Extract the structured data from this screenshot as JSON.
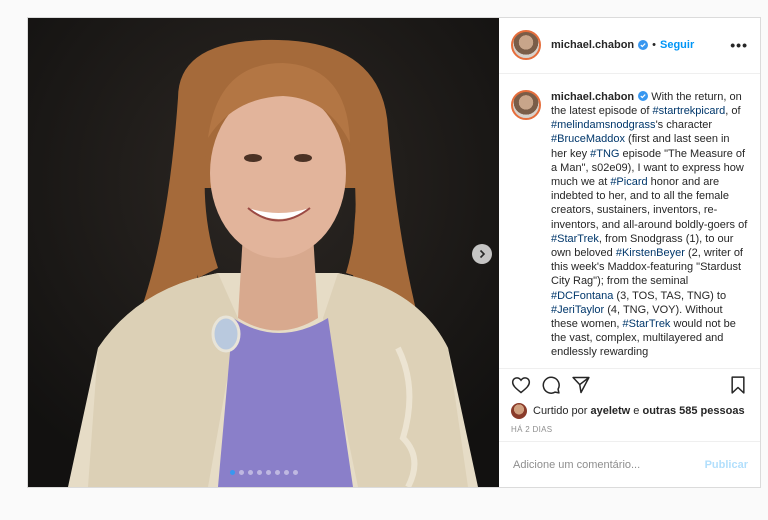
{
  "post": {
    "username": "michael.chabon",
    "separator": "•",
    "follow_label": "Seguir",
    "more_label": "•••",
    "caption": [
      {
        "t": "With the return, on the latest episode of "
      },
      {
        "t": "#startrekpicard",
        "tag": true
      },
      {
        "t": ", of "
      },
      {
        "t": "#melindamsnodgrass",
        "tag": true
      },
      {
        "t": "'s character "
      },
      {
        "t": "#BruceMaddox",
        "tag": true
      },
      {
        "t": " (first and last seen in her key "
      },
      {
        "t": "#TNG",
        "tag": true
      },
      {
        "t": " episode \"The Measure of a Man\", s02e09), I want to express how much we at "
      },
      {
        "t": "#Picard",
        "tag": true
      },
      {
        "t": " honor and are indebted to her, and to all the female creators, sustainers, inventors, re-inventors, and all-around boldly-goers of "
      },
      {
        "t": "#StarTrek",
        "tag": true
      },
      {
        "t": ", from Snodgrass (1), to our own beloved "
      },
      {
        "t": "#KirstenBeyer",
        "tag": true
      },
      {
        "t": " (2, writer of this week's Maddox-featuring \"Stardust City Rag\"); from the seminal "
      },
      {
        "t": "#DCFontana",
        "tag": true
      },
      {
        "t": " (3, TOS, TAS, TNG) to "
      },
      {
        "t": "#JeriTaylor",
        "tag": true
      },
      {
        "t": " (4, TNG, VOY). Without these women, "
      },
      {
        "t": "#StarTrek",
        "tag": true
      },
      {
        "t": " would not be the vast, complex, multilayered and endlessly rewarding"
      }
    ],
    "likes": {
      "prefix": "Curtido por ",
      "user": "ayeletw",
      "middle": " e ",
      "others": "outras 585 pessoas"
    },
    "time": "HÁ 2 DIAS",
    "comment": {
      "placeholder": "Adicione um comentário...",
      "publish_label": "Publicar"
    }
  },
  "carousel": {
    "slide_count": 8,
    "active_index": 0
  },
  "colors": {
    "link": "#0095f6",
    "hashtag": "#00376b",
    "border": "#dbdbdb"
  },
  "icons": [
    "verified-icon",
    "more-icon",
    "heart-icon",
    "comment-icon",
    "share-icon",
    "bookmark-icon",
    "chevron-right-icon"
  ]
}
